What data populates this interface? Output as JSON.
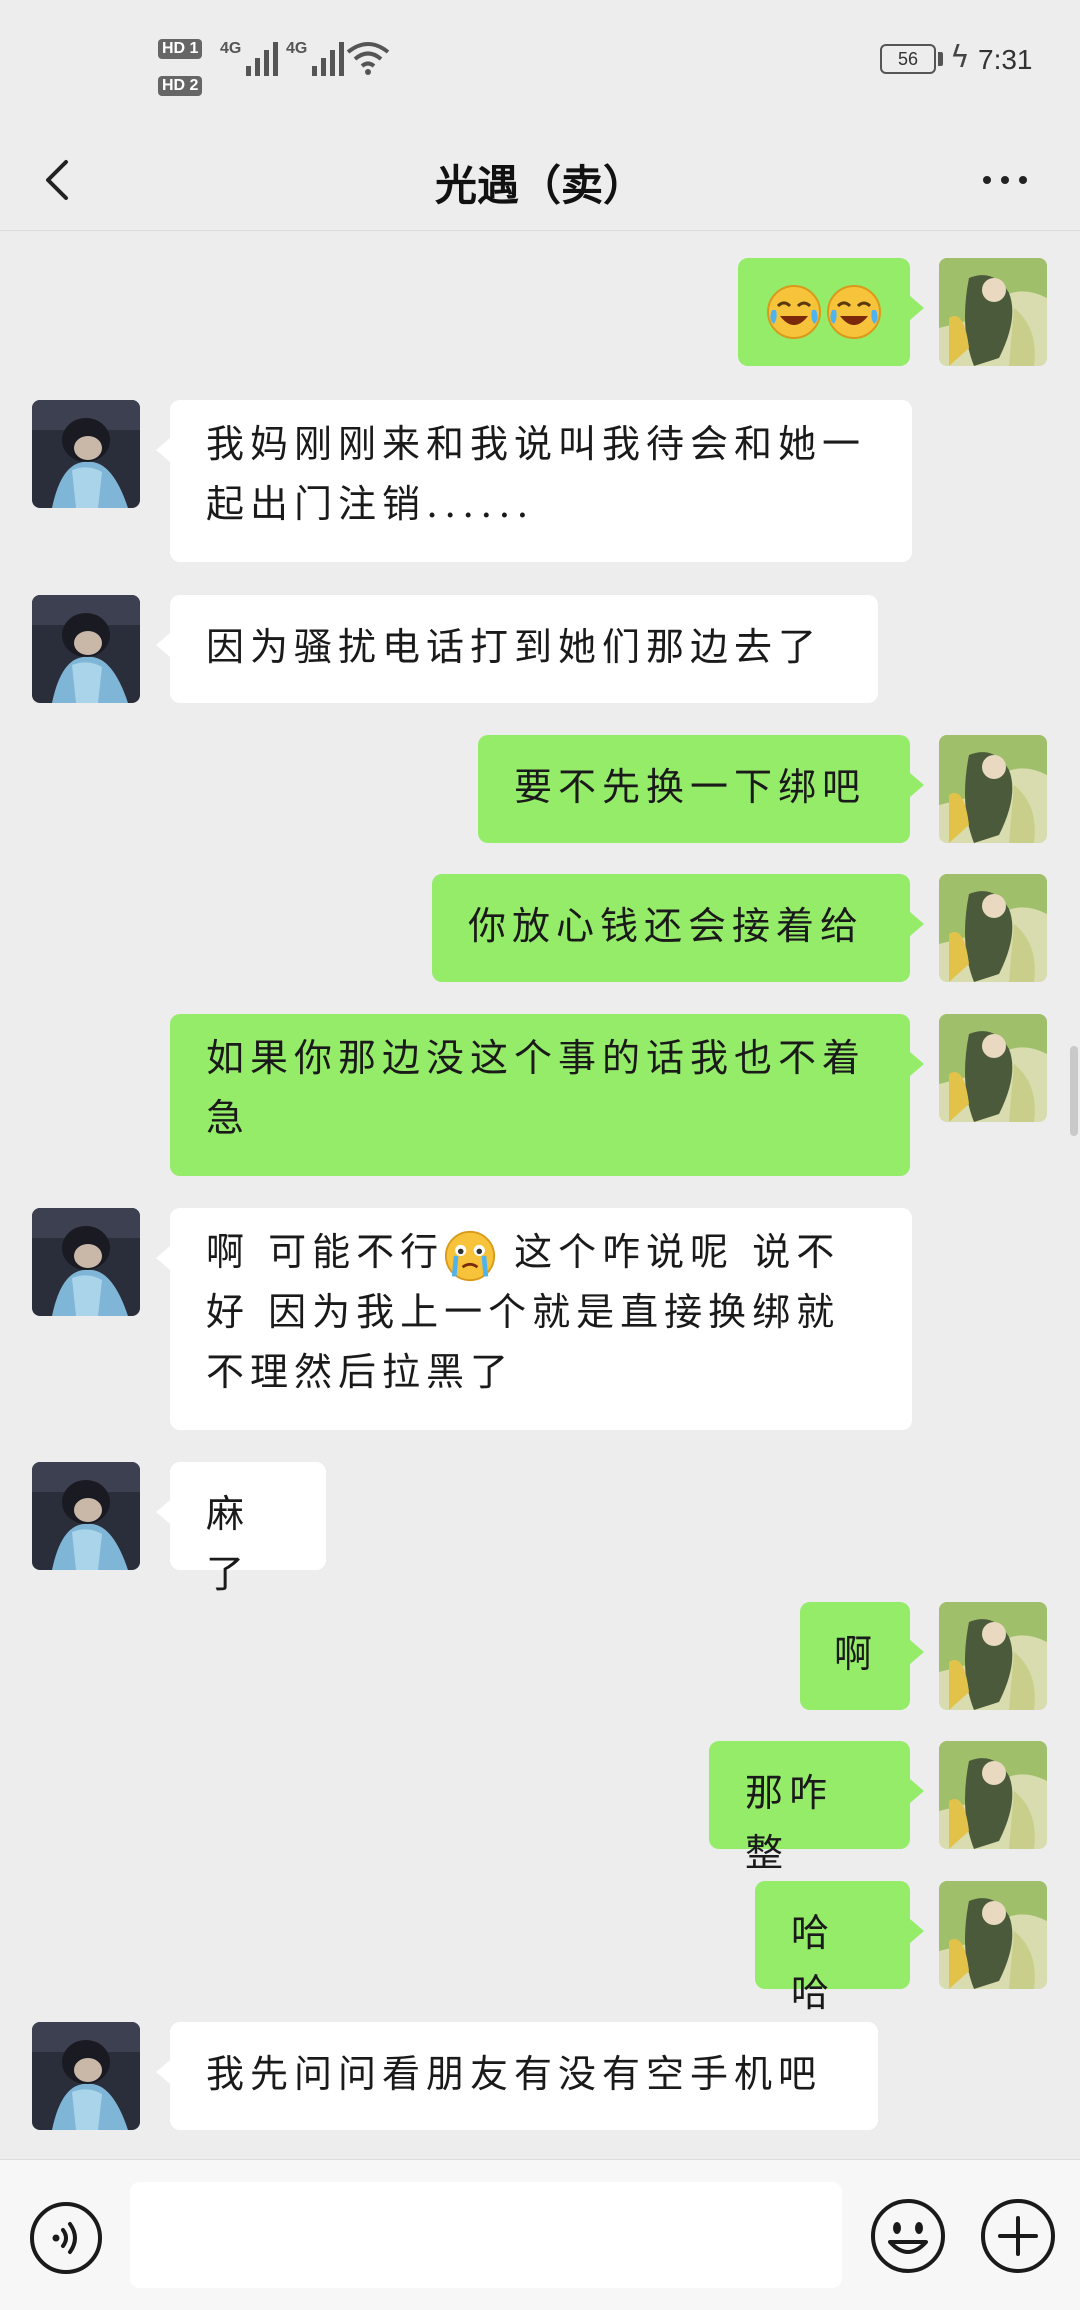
{
  "status_bar": {
    "hd1": "HD 1",
    "hd2": "HD 2",
    "net1": "4G",
    "net2": "4G",
    "battery": "56",
    "time": "7:31"
  },
  "header": {
    "title": "光遇（卖）"
  },
  "colors": {
    "outgoing_bubble": "#95ec69",
    "incoming_bubble": "#ffffff",
    "background": "#ededed"
  },
  "messages": [
    {
      "side": "out",
      "text": "",
      "emoji": [
        "crying-laughing-emoji",
        "crying-laughing-emoji"
      ]
    },
    {
      "side": "in",
      "text": "我妈刚刚来和我说叫我待会和她一起出门注销......"
    },
    {
      "side": "in",
      "text": "因为骚扰电话打到她们那边去了"
    },
    {
      "side": "out",
      "text": "要不先换一下绑吧"
    },
    {
      "side": "out",
      "text": "你放心钱还会接着给"
    },
    {
      "side": "out",
      "text": "如果你那边没这个事的话我也不着急"
    },
    {
      "side": "in",
      "text_a": "啊 可能不行",
      "emoji": [
        "teary-face-emoji"
      ],
      "text_b": " 这个咋说呢 说不好 因为我上一个就是直接换绑就不理然后拉黑了"
    },
    {
      "side": "in",
      "text": "麻了"
    },
    {
      "side": "out",
      "text": "啊"
    },
    {
      "side": "out",
      "text": "那咋整"
    },
    {
      "side": "out",
      "text": "哈哈"
    },
    {
      "side": "in",
      "text": "我先问问看朋友有没有空手机吧"
    }
  ],
  "input_bar": {
    "placeholder": "",
    "icons": [
      "voice-icon",
      "emoji-icon",
      "plus-icon"
    ]
  }
}
